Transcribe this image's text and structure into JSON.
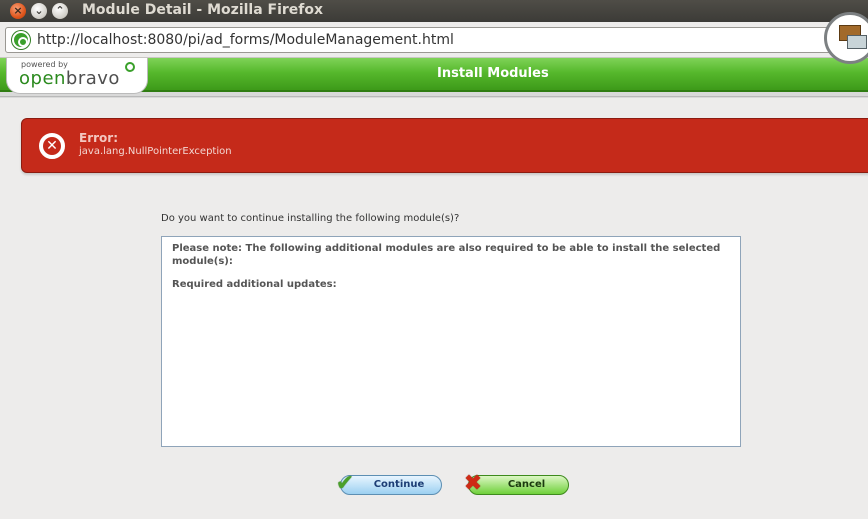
{
  "window": {
    "title": "Module Detail - Mozilla Firefox",
    "buttons": {
      "close": "×",
      "minimize": "⌄",
      "maximize": "⌃"
    }
  },
  "urlbar": {
    "url": "http://localhost:8080/pi/ad_forms/ModuleManagement.html"
  },
  "header": {
    "logo_powered": "powered by",
    "logo_brand_a": "open",
    "logo_brand_b": "bravo",
    "title": "Install Modules"
  },
  "error": {
    "title": "Error:",
    "message": "java.lang.NullPointerException"
  },
  "main": {
    "question": "Do you want to continue installing the following module(s)?",
    "note": "Please note: The following additional modules are also required to be able to install the selected module(s):",
    "updates_label": "Required additional updates:"
  },
  "buttons": {
    "continue": "Continue",
    "cancel": "Cancel"
  }
}
